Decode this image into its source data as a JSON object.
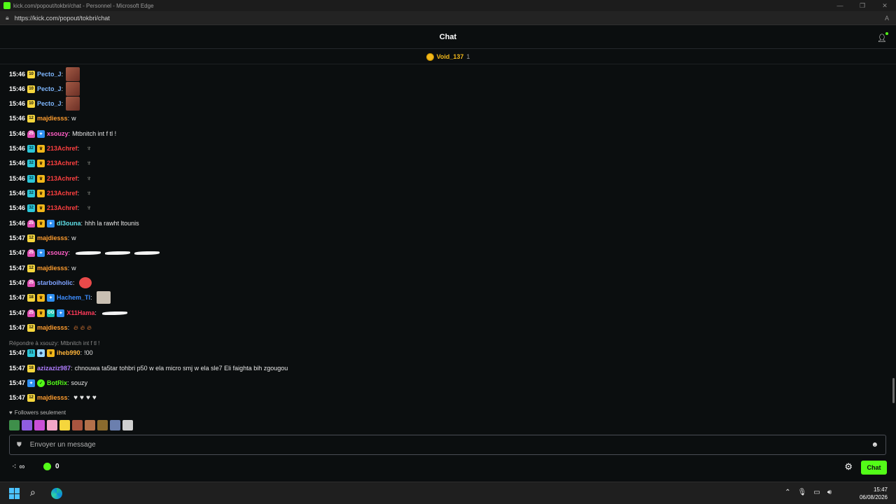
{
  "window": {
    "title": "kick.com/popout/tokbri/chat - Personnel - Microsoft Edge",
    "url": "https://kick.com/popout/tokbri/chat"
  },
  "header": {
    "title": "Chat"
  },
  "pinned_gifter": {
    "name": "Void_137",
    "count": "1"
  },
  "messages": [
    {
      "time": "15:46",
      "badges": [
        {
          "type": "yellow",
          "text": "10"
        }
      ],
      "user": "Pecto_J",
      "color": "#7fb8ff",
      "text": "",
      "emotes": "face"
    },
    {
      "time": "15:46",
      "badges": [
        {
          "type": "yellow",
          "text": "10"
        }
      ],
      "user": "Pecto_J",
      "color": "#7fb8ff",
      "text": "",
      "emotes": "face"
    },
    {
      "time": "15:46",
      "badges": [
        {
          "type": "yellow",
          "text": "10"
        }
      ],
      "user": "Pecto_J",
      "color": "#7fb8ff",
      "text": "",
      "emotes": "face"
    },
    {
      "time": "15:46",
      "badges": [
        {
          "type": "yellow",
          "text": "12"
        }
      ],
      "user": "majdiesss",
      "color": "#ff9d2e",
      "text": "w"
    },
    {
      "time": "15:46",
      "badges": [
        {
          "type": "pink",
          "text": "25"
        },
        {
          "type": "blue",
          "text": "✦"
        }
      ],
      "user": "xsouzy",
      "color": "#ff5fc6",
      "text": "Mtbnitch int f tl !"
    },
    {
      "time": "15:46",
      "badges": [
        {
          "type": "cyan",
          "text": "32"
        },
        {
          "type": "crown",
          "text": "♛"
        }
      ],
      "user": "213Achref",
      "color": "#ff4040",
      "text": "",
      "emotes": "cactus"
    },
    {
      "time": "15:46",
      "badges": [
        {
          "type": "cyan",
          "text": "32"
        },
        {
          "type": "crown",
          "text": "♛"
        }
      ],
      "user": "213Achref",
      "color": "#ff4040",
      "text": "",
      "emotes": "cactus"
    },
    {
      "time": "15:46",
      "badges": [
        {
          "type": "cyan",
          "text": "32"
        },
        {
          "type": "crown",
          "text": "♛"
        }
      ],
      "user": "213Achref",
      "color": "#ff4040",
      "text": "",
      "emotes": "cactus"
    },
    {
      "time": "15:46",
      "badges": [
        {
          "type": "cyan",
          "text": "32"
        },
        {
          "type": "crown",
          "text": "♛"
        }
      ],
      "user": "213Achref",
      "color": "#ff4040",
      "text": "",
      "emotes": "cactus"
    },
    {
      "time": "15:46",
      "badges": [
        {
          "type": "cyan",
          "text": "32"
        },
        {
          "type": "crown",
          "text": "♛"
        }
      ],
      "user": "213Achref",
      "color": "#ff4040",
      "text": "",
      "emotes": "cactus"
    },
    {
      "time": "15:46",
      "badges": [
        {
          "type": "pink",
          "text": "25"
        },
        {
          "type": "crown",
          "text": "♛"
        },
        {
          "type": "blue",
          "text": "✦"
        }
      ],
      "user": "dl3ouna",
      "color": "#5fe0e8",
      "text": "hhh la rawht ltounis"
    },
    {
      "time": "15:47",
      "badges": [
        {
          "type": "yellow",
          "text": "12"
        }
      ],
      "user": "majdiesss",
      "color": "#ff9d2e",
      "text": "w"
    },
    {
      "time": "15:47",
      "badges": [
        {
          "type": "pink",
          "text": "25"
        },
        {
          "type": "blue",
          "text": "✦"
        }
      ],
      "user": "xsouzy",
      "color": "#ff5fc6",
      "text": "",
      "emotes": "goose3"
    },
    {
      "time": "15:47",
      "badges": [
        {
          "type": "yellow",
          "text": "12"
        }
      ],
      "user": "majdiesss",
      "color": "#ff9d2e",
      "text": "w"
    },
    {
      "time": "15:47",
      "badges": [
        {
          "type": "pink",
          "text": "25"
        }
      ],
      "user": "starboiholic",
      "color": "#7fa2ff",
      "text": "",
      "emotes": "round"
    },
    {
      "time": "15:47",
      "badges": [
        {
          "type": "yellow",
          "text": "18"
        },
        {
          "type": "crown",
          "text": "♛"
        },
        {
          "type": "blue",
          "text": "✦"
        }
      ],
      "user": "Hachem_Tl",
      "color": "#3d8dff",
      "text": "",
      "emotes": "dog"
    },
    {
      "time": "15:47",
      "badges": [
        {
          "type": "pink",
          "text": "25"
        },
        {
          "type": "crown",
          "text": "♛"
        },
        {
          "type": "teal",
          "text": "OG"
        },
        {
          "type": "blue",
          "text": "✦"
        }
      ],
      "user": "X11Hama",
      "color": "#ff3a5a",
      "text": "",
      "emotes": "goose1"
    },
    {
      "time": "15:47",
      "badges": [
        {
          "type": "yellow",
          "text": "12"
        }
      ],
      "user": "majdiesss",
      "color": "#ff9d2e",
      "text": "",
      "emotes": "fire3"
    },
    {
      "reply": "Répondre à xsouzy: Mtbnitch int f tl !"
    },
    {
      "time": "15:47",
      "badges": [
        {
          "type": "cyan",
          "text": "31"
        },
        {
          "type": "gem",
          "text": "◆"
        },
        {
          "type": "crown",
          "text": "♛"
        }
      ],
      "user": "iheb990",
      "color": "#ffb43a",
      "text": "!00"
    },
    {
      "time": "15:47",
      "badges": [
        {
          "type": "yellow",
          "text": "18"
        }
      ],
      "user": "azizaziz987",
      "color": "#b07dff",
      "text": "chnouwa ta5tar tohbri p50 w ela micro smj w ela sle7 Eli faighta bih zgougou"
    },
    {
      "time": "15:47",
      "badges": [
        {
          "type": "blue",
          "text": "✦"
        },
        {
          "type": "green",
          "text": "✓"
        }
      ],
      "user": "BotRix",
      "color": "#53fc18",
      "text": "souzy"
    },
    {
      "time": "15:47",
      "badges": [
        {
          "type": "yellow",
          "text": "12"
        }
      ],
      "user": "majdiesss",
      "color": "#ff9d2e",
      "text": "",
      "emotes": "heart4"
    }
  ],
  "followers_only": "Followers seulement",
  "quick_emote_colors": [
    "#3e8f4a",
    "#8f5de0",
    "#c94fd6",
    "#f2a6c8",
    "#f5d63d",
    "#a9553f",
    "#b2704a",
    "#8a6a2d",
    "#6b7fae",
    "#d0d0d0"
  ],
  "input": {
    "placeholder": "Envoyer un message"
  },
  "bottom": {
    "infinity": "∞",
    "points": "0",
    "send_label": "Chat"
  },
  "taskbar": {
    "time": "15:47",
    "date": "06/08/2026"
  }
}
